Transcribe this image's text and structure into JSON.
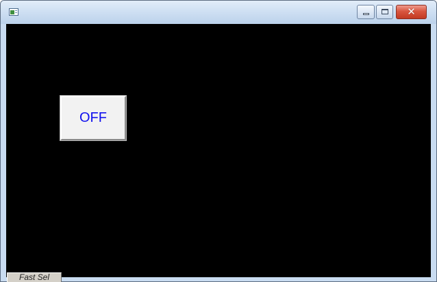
{
  "window": {
    "title": "",
    "icon": "app-window-icon",
    "controls": {
      "minimize_icon": "minimize-icon",
      "maximize_icon": "maximize-icon",
      "close_icon": "close-icon",
      "close_glyph": "✕",
      "close_color": "#c23a22"
    }
  },
  "canvas": {
    "background": "#000000"
  },
  "state_button": {
    "label": "OFF",
    "text_color": "#1111ee"
  },
  "bottom_tab": {
    "label": "Fast Sel"
  }
}
